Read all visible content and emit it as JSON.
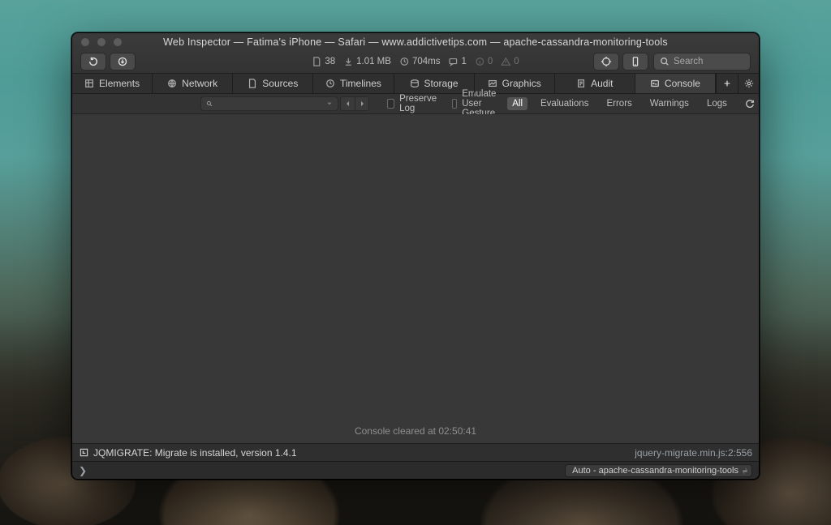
{
  "window": {
    "title": "Web Inspector — Fatima's iPhone — Safari — www.addictivetips.com — apache-cassandra-monitoring-tools"
  },
  "toolbar": {
    "metrics": {
      "resources": "38",
      "size": "1.01 MB",
      "time": "704ms",
      "messages": "1",
      "info_count": "0",
      "warn_count": "0"
    },
    "search_placeholder": "Search"
  },
  "tabs": {
    "elements": "Elements",
    "network": "Network",
    "sources": "Sources",
    "timelines": "Timelines",
    "storage": "Storage",
    "graphics": "Graphics",
    "audit": "Audit",
    "console": "Console"
  },
  "filterbar": {
    "preserve": "Preserve Log",
    "emulate": "Emulate User Gesture",
    "all": "All",
    "evaluations": "Evaluations",
    "errors": "Errors",
    "warnings": "Warnings",
    "logs": "Logs"
  },
  "console": {
    "cleared": "Console cleared at 02:50:41",
    "log_message": "JQMIGRATE: Migrate is installed, version 1.4.1",
    "log_source": "jquery-migrate.min.js:2:556",
    "context": "Auto - apache-cassandra-monitoring-tools"
  }
}
